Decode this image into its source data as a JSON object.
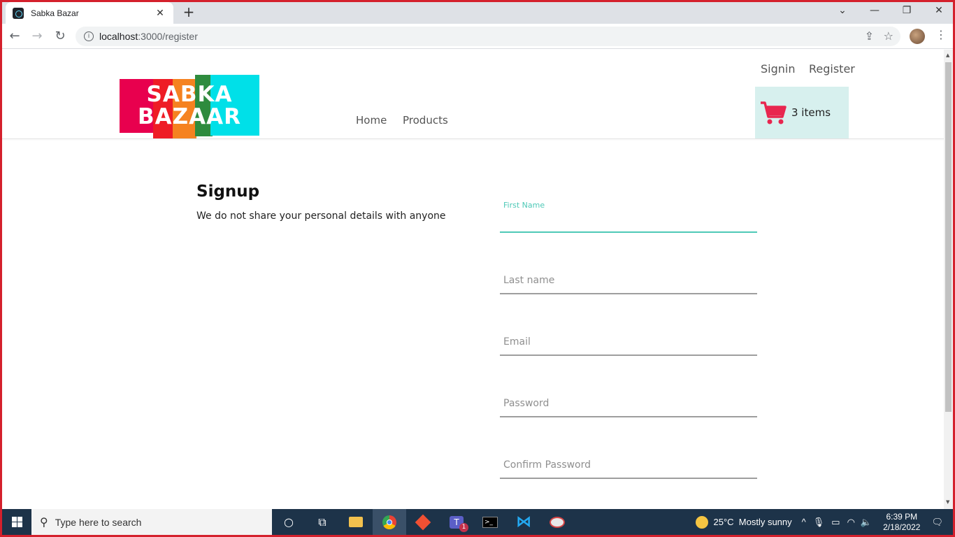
{
  "browser": {
    "tab_title": "Sabka Bazar",
    "tab_close": "✕",
    "new_tab": "+",
    "url_host": "localhost",
    "url_path": ":3000/register",
    "window_controls": [
      "⌄",
      "—",
      "❐",
      "✕"
    ]
  },
  "header": {
    "logo_line1": "SABKA",
    "logo_line2": "BAZAAR",
    "top_links": {
      "signin": "Signin",
      "register": "Register"
    },
    "nav": {
      "home": "Home",
      "products": "Products"
    },
    "cart": {
      "label": "3 items",
      "icon": "cart-icon",
      "color": "#e8264f"
    }
  },
  "signup": {
    "title": "Signup",
    "subtitle": "We do not share your personal details with anyone",
    "fields": {
      "first_name": {
        "label": "First Name",
        "value": ""
      },
      "last_name": {
        "placeholder": "Last name"
      },
      "email": {
        "placeholder": "Email"
      },
      "password": {
        "placeholder": "Password"
      },
      "confirm_password": {
        "placeholder": "Confirm Password"
      }
    },
    "accent_color": "#4ec9b7"
  },
  "taskbar": {
    "search_placeholder": "Type here to search",
    "weather": "25°C  Mostly sunny",
    "time": "6:39 PM",
    "date": "2/18/2022",
    "teams_badge": "1"
  }
}
